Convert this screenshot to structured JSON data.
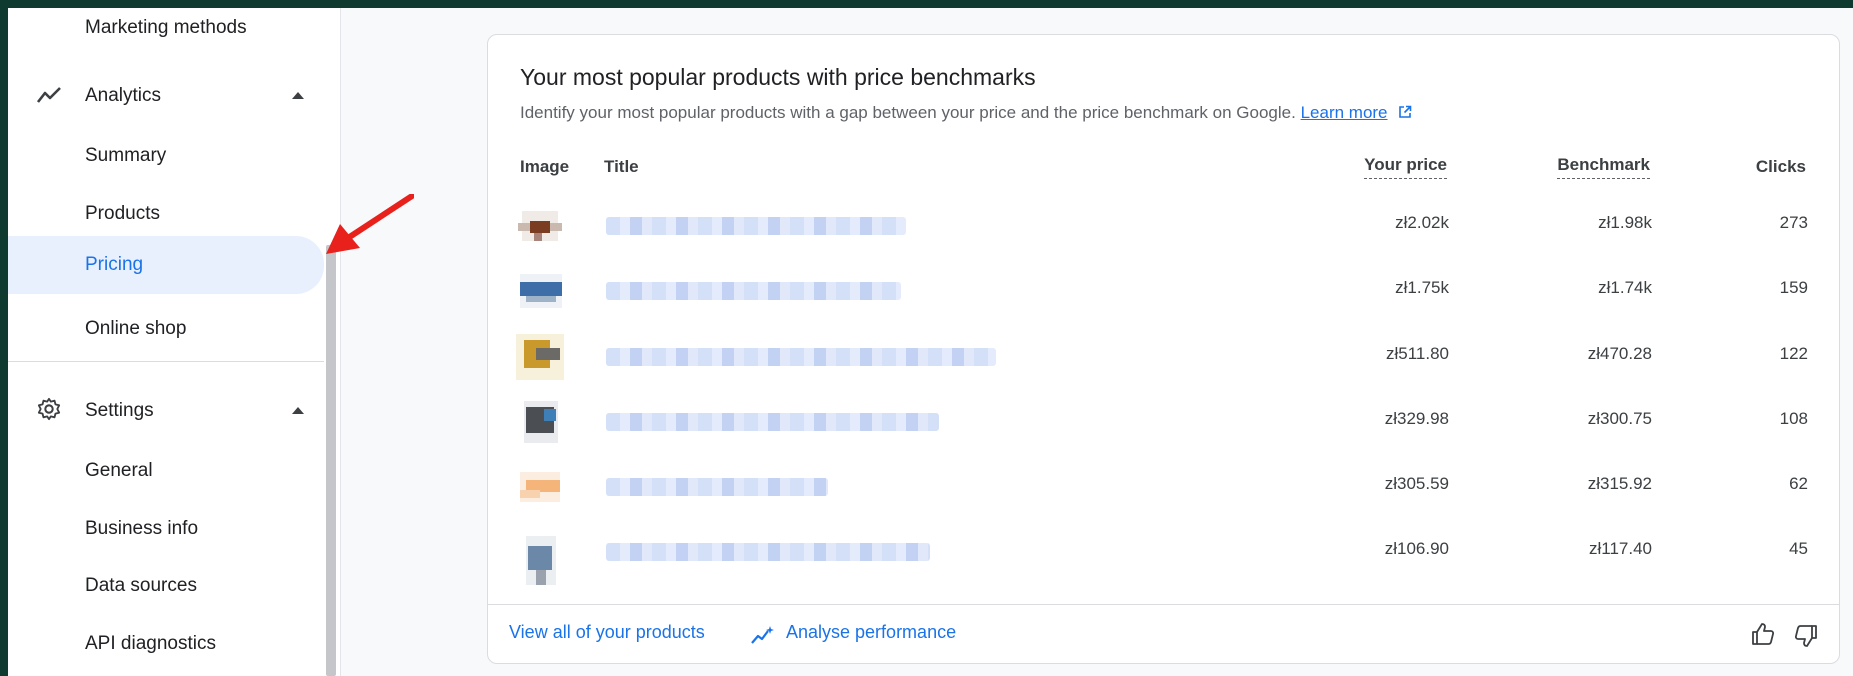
{
  "sidebar": {
    "marketing_methods": "Marketing methods",
    "analytics": "Analytics",
    "summary": "Summary",
    "products": "Products",
    "pricing": "Pricing",
    "online_shop": "Online shop",
    "settings": "Settings",
    "general": "General",
    "business_info": "Business info",
    "data_sources": "Data sources",
    "api_diagnostics": "API diagnostics"
  },
  "card": {
    "title": "Your most popular products with price benchmarks",
    "subtitle": "Identify your most popular products with a gap between your price and the price benchmark on Google.",
    "learn_more": "Learn more",
    "columns": {
      "image": "Image",
      "title": "Title",
      "your_price": "Your price",
      "benchmark": "Benchmark",
      "clicks": "Clicks"
    },
    "rows": [
      {
        "price": "zł2.02k",
        "benchmark": "zł1.98k",
        "clicks": "273"
      },
      {
        "price": "zł1.75k",
        "benchmark": "zł1.74k",
        "clicks": "159"
      },
      {
        "price": "zł511.80",
        "benchmark": "zł470.28",
        "clicks": "122"
      },
      {
        "price": "zł329.98",
        "benchmark": "zł300.75",
        "clicks": "108"
      },
      {
        "price": "zł305.59",
        "benchmark": "zł315.92",
        "clicks": "62"
      },
      {
        "price": "zł106.90",
        "benchmark": "zł117.40",
        "clicks": "45"
      }
    ],
    "footer": {
      "view_all": "View all of your products",
      "analyse": "Analyse performance"
    }
  },
  "colors": {
    "accent": "#1a73e8",
    "active_bg": "#e8f0fe",
    "frame": "#0f3a30",
    "arrow": "#e8211c"
  }
}
